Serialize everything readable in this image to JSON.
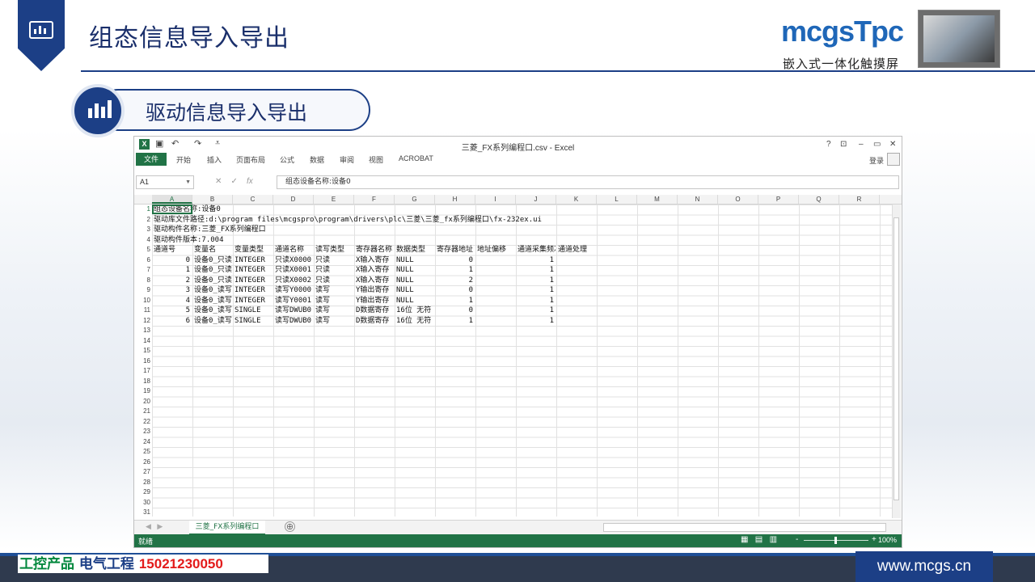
{
  "slide": {
    "title": "组态信息导入导出",
    "brand": "mcgsTpc",
    "brand_sub": "嵌入式一体化触摸屏",
    "section_title": "驱动信息导入导出",
    "footer_contact_1": "工控产品",
    "footer_contact_2": "电气工程",
    "footer_contact_3": "15021230050",
    "footer_url": "www.mcgs.cn"
  },
  "excel": {
    "window_title": "三菱_FX系列编程口.csv - Excel",
    "app_icon": "X",
    "quick_access": [
      "save-icon",
      "undo-icon",
      "redo-icon",
      "customize-icon"
    ],
    "window_controls": [
      "?",
      "⊡",
      "–",
      "▭",
      "✕"
    ],
    "ribbon_tabs": [
      "文件",
      "开始",
      "插入",
      "页面布局",
      "公式",
      "数据",
      "审阅",
      "视图",
      "ACROBAT"
    ],
    "login": "登录",
    "name_box": "A1",
    "formula_value": "组态设备名称:设备0",
    "columns": [
      "A",
      "B",
      "C",
      "D",
      "E",
      "F",
      "G",
      "H",
      "I",
      "J",
      "K",
      "L",
      "M",
      "N",
      "O",
      "P",
      "Q",
      "R"
    ],
    "rows": [
      "1",
      "2",
      "3",
      "4",
      "5",
      "6",
      "7",
      "8",
      "9",
      "10",
      "11",
      "12",
      "13",
      "14",
      "15",
      "16",
      "17",
      "18",
      "19",
      "20",
      "21",
      "22",
      "23",
      "24",
      "25",
      "26",
      "27",
      "28",
      "29",
      "30",
      "31"
    ],
    "info_lines": [
      "组态设备名称:设备0",
      "驱动库文件路径:d:\\program files\\mcgspro\\program\\drivers\\plc\\三菱\\三菱_fx系列编程口\\fx-232ex.ui",
      "驱动构件名称:三菱_FX系列编程口",
      "驱动构件版本:7.004"
    ],
    "headers": [
      "通道号",
      "变量名",
      "变量类型",
      "通道名称",
      "读写类型",
      "寄存器名称",
      "数据类型",
      "寄存器地址",
      "地址偏移",
      "通道采集频次",
      "通道处理"
    ],
    "data_rows": [
      [
        "0",
        "设备0_只读",
        "INTEGER",
        "只读X0000",
        "只读",
        "X输入寄存",
        "NULL",
        "0",
        "",
        "1",
        ""
      ],
      [
        "1",
        "设备0_只读",
        "INTEGER",
        "只读X0001",
        "只读",
        "X输入寄存",
        "NULL",
        "1",
        "",
        "1",
        ""
      ],
      [
        "2",
        "设备0_只读",
        "INTEGER",
        "只读X0002",
        "只读",
        "X输入寄存",
        "NULL",
        "2",
        "",
        "1",
        ""
      ],
      [
        "3",
        "设备0_读写",
        "INTEGER",
        "读写Y0000",
        "读写",
        "Y输出寄存",
        "NULL",
        "0",
        "",
        "1",
        ""
      ],
      [
        "4",
        "设备0_读写",
        "INTEGER",
        "读写Y0001",
        "读写",
        "Y输出寄存",
        "NULL",
        "1",
        "",
        "1",
        ""
      ],
      [
        "5",
        "设备0_读写",
        "SINGLE",
        "读写DWUB0",
        "读写",
        "D数据寄存",
        "16位 无符",
        "0",
        "",
        "1",
        ""
      ],
      [
        "6",
        "设备0_读写",
        "SINGLE",
        "读写DWUB0",
        "读写",
        "D数据寄存",
        "16位 无符",
        "1",
        "",
        "1",
        ""
      ]
    ],
    "sheet_tab": "三菱_FX系列编程口",
    "sheet_add": "⊕",
    "status_ready": "就绪",
    "zoom": "100%"
  }
}
